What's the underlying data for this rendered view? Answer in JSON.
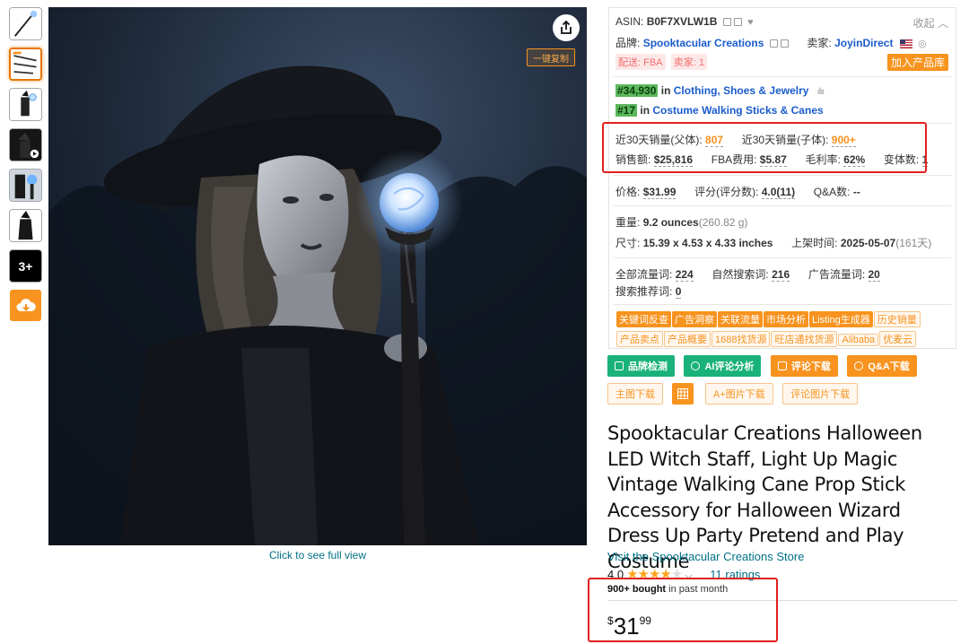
{
  "thumbnails": [
    {
      "name": "thumb-staff-product",
      "active": false
    },
    {
      "name": "thumb-staff-parts",
      "active": true
    },
    {
      "name": "thumb-witch-costume",
      "active": false
    },
    {
      "name": "thumb-video",
      "active": false
    },
    {
      "name": "thumb-staff-orb",
      "active": false
    },
    {
      "name": "thumb-witch-full",
      "active": false
    },
    {
      "name": "thumb-more",
      "active": false,
      "label": "3+"
    }
  ],
  "main_image": {
    "full_view_text": "Click to see full view",
    "mini_button_label": "一键复制"
  },
  "panel": {
    "asin_label": "ASIN:",
    "asin_value": "B0F7XVLW1B",
    "collapse_label": "收起",
    "brand_label": "品牌:",
    "brand_value": "Spooktacular Creations",
    "seller_label": "卖家:",
    "seller_value": "JoyinDirect",
    "tag_fba": "配送: FBA",
    "tag_sellers": "卖家: 1",
    "add_library": "加入产品库",
    "rank1_badge": "#34,930",
    "rank1_in": "in",
    "rank1_cat": "Clothing, Shoes & Jewelry",
    "rank2_badge": "#17",
    "rank2_in": "in",
    "rank2_cat": "Costume Walking Sticks & Canes",
    "sales30_parent_label": "近30天销量(父体):",
    "sales30_parent_value": "807",
    "sales30_child_label": "近30天销量(子体):",
    "sales30_child_value": "900+",
    "revenue_label": "销售额:",
    "revenue_value": "$25,816",
    "fba_fee_label": "FBA费用:",
    "fba_fee_value": "$5.87",
    "margin_label": "毛利率:",
    "margin_value": "62%",
    "variants_label": "变体数:",
    "variants_value": "1",
    "price_label": "价格:",
    "price_value": "$31.99",
    "rating_label": "评分(评分数):",
    "rating_value": "4.0(11)",
    "qa_label": "Q&A数:",
    "qa_value": "--",
    "weight_label": "重量:",
    "weight_value": "9.2 ounces",
    "weight_grams": "(260.82 g)",
    "dims_label": "尺寸:",
    "dims_value": "15.39 x 4.53 x 4.33 inches",
    "listed_label": "上架时间:",
    "listed_value": "2025-05-07",
    "listed_days": "(161天)",
    "traffic_all_label": "全部流量词:",
    "traffic_all_value": "224",
    "organic_label": "自然搜索词:",
    "organic_value": "216",
    "ad_label": "广告流量词:",
    "ad_value": "20",
    "recommend_label": "搜索推荐词:",
    "recommend_value": "0",
    "tool_tags_solid": [
      "关键词反查",
      "广告洞察",
      "关联流量",
      "市场分析",
      "Listing生成器"
    ],
    "tool_tags_outline": [
      "历史销量",
      "产品卖点",
      "产品概要",
      "1688找货源",
      "旺店通找货源",
      "Alibaba",
      "优麦云"
    ]
  },
  "actions": {
    "brand_check": "品牌检测",
    "ai_review": "AI评论分析",
    "review_download": "评论下载",
    "qa_download": "Q&A下载",
    "main_image_download": "主图下载",
    "aplus_download": "A+图片下载",
    "review_image_download": "评论图片下载"
  },
  "product": {
    "title": "Spooktacular Creations Halloween LED Witch Staff, Light Up Magic Vintage Walking Cane Prop Stick Accessory for Halloween Wizard Dress Up Party Pretend and Play Costume",
    "store_link": "Visit the Spooktacular Creations Store",
    "rating_value": "4.0",
    "stars": 4,
    "ratings_count": "11 ratings",
    "bought_bold": "900+ bought",
    "bought_rest": " in past month",
    "price_symbol": "$",
    "price_whole": "31",
    "price_fraction": "99"
  }
}
